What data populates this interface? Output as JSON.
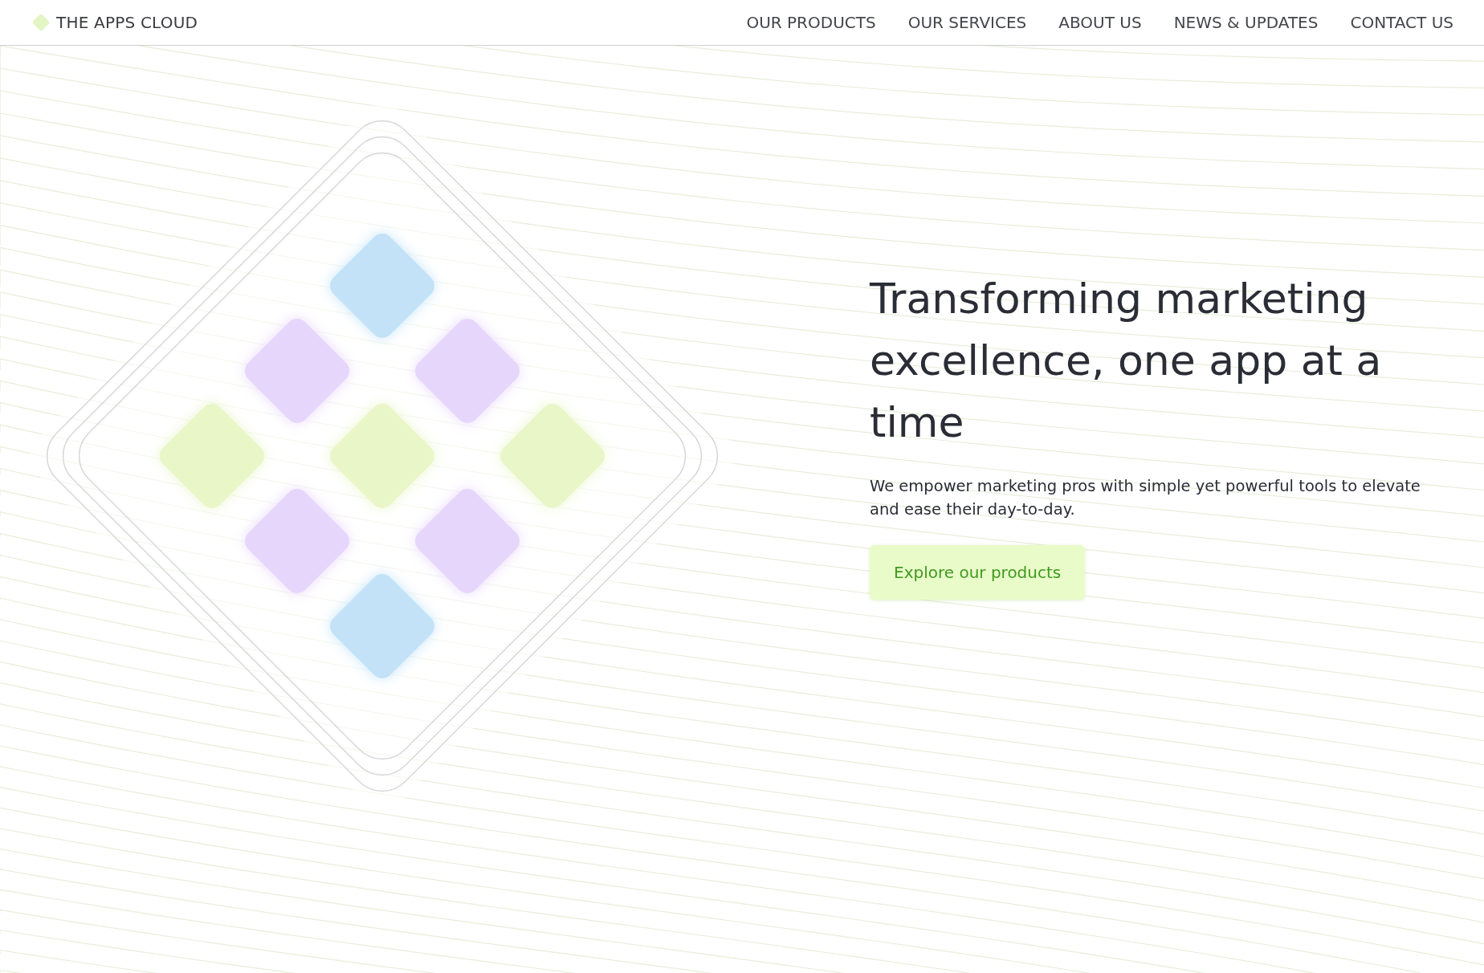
{
  "header": {
    "logo_text": "THE APPS CLOUD",
    "nav": [
      {
        "label": "OUR PRODUCTS"
      },
      {
        "label": "OUR SERVICES"
      },
      {
        "label": "ABOUT US"
      },
      {
        "label": "NEWS & UPDATES"
      },
      {
        "label": "CONTACT US"
      }
    ]
  },
  "hero": {
    "heading": "Transforming marketing excellence, one app at a time",
    "text": "We empower marketing pros with simple yet powerful tools to elevate and ease their day-to-day.",
    "button": "Explore our products"
  }
}
